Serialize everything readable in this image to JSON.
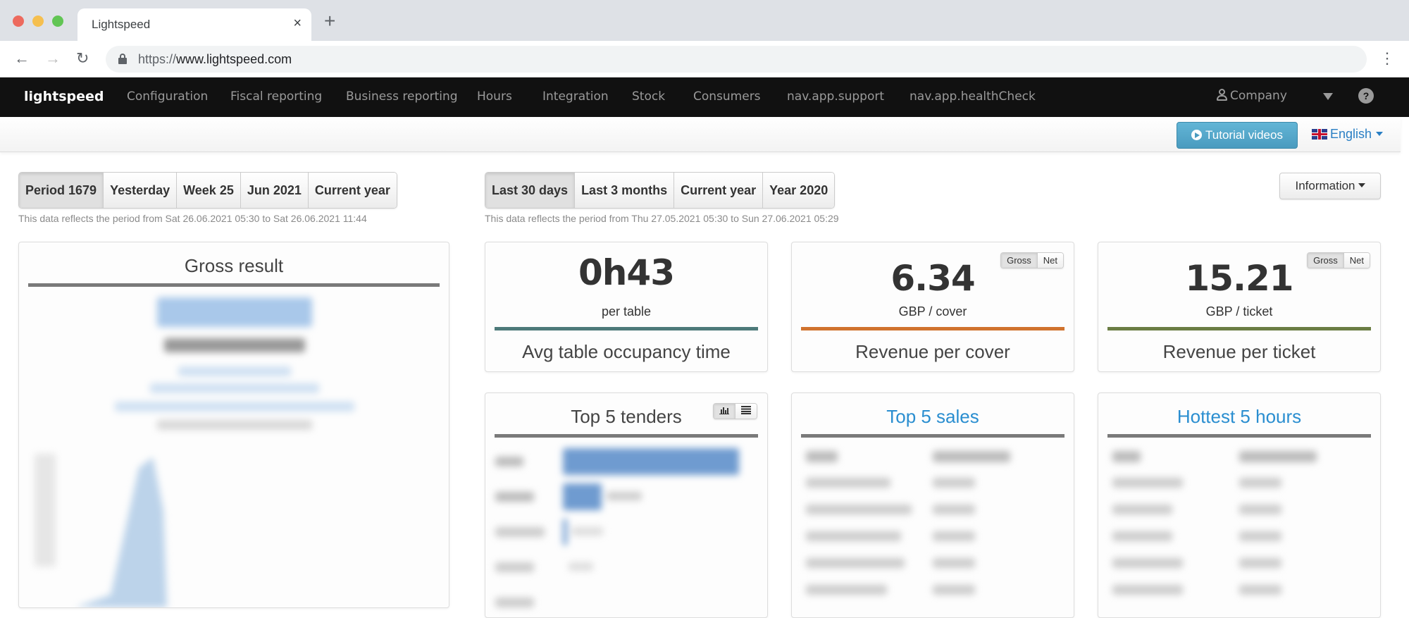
{
  "browser": {
    "tab_title": "Lightspeed",
    "tab_close": "×",
    "new_tab": "+",
    "url_scheme": "https://",
    "url_host": "www.lightspeed.com",
    "back_icon": "←",
    "forward_icon": "→",
    "reload_icon": "↻",
    "menu_icon": "⋮"
  },
  "navbar": {
    "brand": "lightspeed",
    "items": [
      "Configuration",
      "Fiscal reporting",
      "Business reporting",
      "Hours",
      "Integration",
      "Stock",
      "Consumers",
      "nav.app.support",
      "nav.app.healthCheck"
    ],
    "user": "Company",
    "help": "?"
  },
  "subbar": {
    "tutorial": "Tutorial videos",
    "language": "English"
  },
  "left_period": {
    "buttons": [
      "Period 1679",
      "Yesterday",
      "Week 25",
      "Jun 2021",
      "Current year"
    ],
    "active": "Period 1679",
    "note": "This data reflects the period from Sat 26.06.2021 05:30 to Sat 26.06.2021 11:44"
  },
  "right_period": {
    "buttons": [
      "Last 30 days",
      "Last 3 months",
      "Current year",
      "Year 2020"
    ],
    "active": "Last 30 days",
    "note": "This data reflects the period from Thu 27.05.2021 05:30 to Sun 27.06.2021 05:29"
  },
  "information_button": "Information",
  "gross_result": {
    "title": "Gross result"
  },
  "kpis": [
    {
      "value": "0h43",
      "unit": "per table",
      "title": "Avg table occupancy time",
      "color": "#4d7a7a"
    },
    {
      "value": "6.34",
      "unit": "GBP / cover",
      "title": "Revenue per cover",
      "color": "#d0732e",
      "toggle": [
        "Gross",
        "Net"
      ],
      "toggle_active": "Gross"
    },
    {
      "value": "15.21",
      "unit": "GBP / ticket",
      "title": "Revenue per ticket",
      "color": "#6b7d44",
      "toggle": [
        "Gross",
        "Net"
      ],
      "toggle_active": "Gross"
    }
  ],
  "top_tenders": {
    "title": "Top 5 tenders",
    "chart_icon": "bar-chart-icon",
    "list_icon": "list-icon"
  },
  "top_sales": {
    "title": "Top 5 sales"
  },
  "hottest_hours": {
    "title": "Hottest 5 hours"
  },
  "colors": {
    "accent_blue": "#2a8ed0",
    "tutorial_btn": "#55a8cb",
    "navbar_bg": "#111111"
  }
}
